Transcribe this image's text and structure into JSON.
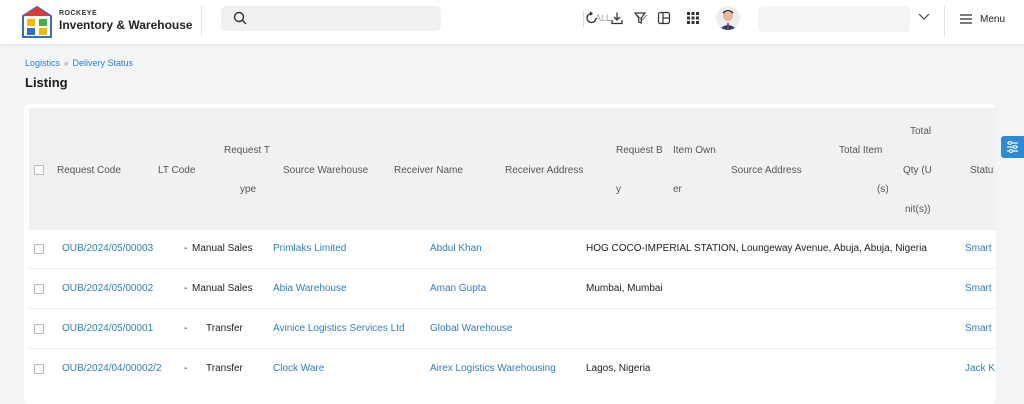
{
  "brand": {
    "small": "ROCKEYE",
    "name": "Inventory & Warehouse"
  },
  "search": {
    "placeholder": "",
    "scope": "ALL"
  },
  "header": {
    "menu_label": "Menu"
  },
  "breadcrumb": {
    "items": [
      "Logistics",
      "Delivery Status"
    ]
  },
  "page": {
    "title": "Listing"
  },
  "table": {
    "columns": {
      "request_code": "Request Code",
      "lt_code": "LT Code",
      "request_type_1": "Request T",
      "request_type_2": "ype",
      "source_warehouse": "Source Warehouse",
      "receiver_name": "Receiver Name",
      "receiver_address": "Receiver Address",
      "request_by_1": "Request B",
      "request_by_2": "y",
      "item_owner_1": "Item Own",
      "item_owner_2": "er",
      "source_address": "Source Address",
      "total_items_1": "Total Item",
      "total_items_2": "(s)",
      "total_qty_1": "Total",
      "total_qty_2": "Qty (U",
      "total_qty_3": "nit(s))",
      "status": "Statu"
    },
    "rows": [
      {
        "request_code": "OUB/2024/05/00003",
        "lt_code": "-",
        "request_type": "Manual Sales",
        "source_warehouse": "Primlaks Limited",
        "receiver_name": "Abdul Khan",
        "receiver_address": "HOG COCO-IMPERIAL STATION, Loungeway Avenue, Abuja, Abuja, Nigeria",
        "status": "Smart"
      },
      {
        "request_code": "OUB/2024/05/00002",
        "lt_code": "-",
        "request_type": "Manual Sales",
        "source_warehouse": "Abia Warehouse",
        "receiver_name": "Aman Gupta",
        "receiver_address": "Mumbai, Mumbai",
        "status": "Smart"
      },
      {
        "request_code": "OUB/2024/05/00001",
        "lt_code": "-",
        "request_type": "Transfer",
        "source_warehouse": "Avinice Logistics Services Ltd",
        "receiver_name": "Global Warehouse",
        "receiver_address": "",
        "status": "Smart"
      },
      {
        "request_code": "OUB/2024/04/00002/2",
        "lt_code": "-",
        "request_type": "Transfer",
        "source_warehouse": "Clock Ware",
        "receiver_name": "Airex Logistics Warehousing",
        "receiver_address": "Lagos, Nigeria",
        "status": "Jack K"
      }
    ]
  },
  "colors": {
    "accent": "#2f7ec6",
    "side_tab": "#2f8ad6"
  }
}
